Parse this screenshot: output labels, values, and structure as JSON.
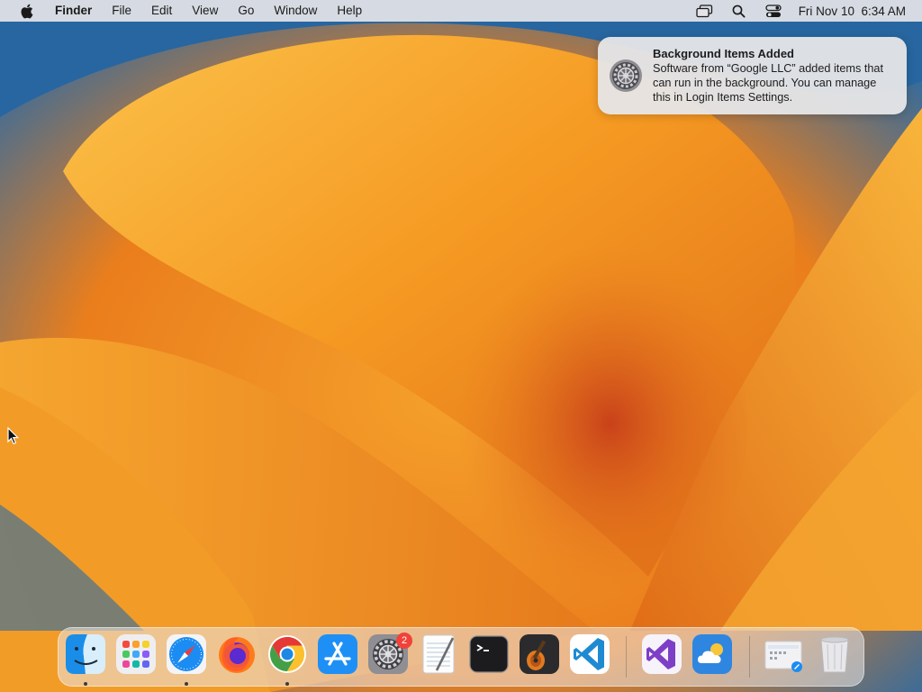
{
  "menubar": {
    "app_name": "Finder",
    "menus": [
      "File",
      "Edit",
      "View",
      "Go",
      "Window",
      "Help"
    ],
    "clock": "Fri Nov 10  6:34 AM"
  },
  "notification": {
    "title": "Background Items Added",
    "body": "Software from “Google LLC” added items that can run in the background. You can manage this in Login Items Settings."
  },
  "dock": {
    "apps": [
      "Finder",
      "Launchpad",
      "Safari",
      "Firefox",
      "Google Chrome",
      "App Store",
      "System Settings",
      "TextEdit",
      "Terminal",
      "GarageBand",
      "Visual Studio Code",
      "Visual Studio",
      "Weather",
      "Downloads",
      "Trash"
    ],
    "settings_badge": "2"
  },
  "colors": {
    "accent_orange": "#f08a1e",
    "wallpaper_blue": "#1f5d95",
    "badge_red": "#f0423a"
  }
}
